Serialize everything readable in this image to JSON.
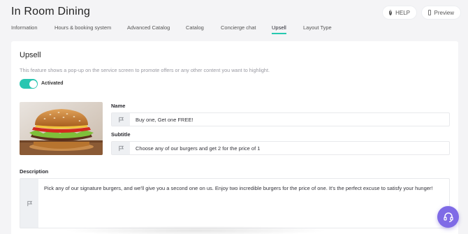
{
  "header": {
    "title": "In Room Dining",
    "help_label": "HELP",
    "preview_label": "Preview"
  },
  "tabs": [
    {
      "label": "Information",
      "active": false
    },
    {
      "label": "Hours & booking system",
      "active": false
    },
    {
      "label": "Advanced Catalog",
      "active": false
    },
    {
      "label": "Catalog",
      "active": false
    },
    {
      "label": "Concierge chat",
      "active": false
    },
    {
      "label": "Upsell",
      "active": true
    },
    {
      "label": "Layout Type",
      "active": false
    }
  ],
  "upsell": {
    "title": "Upsell",
    "description": "This feature shows a pop-up on the service screen to promote offers or any other content you want to highlight.",
    "toggle_label": "Activated",
    "toggle_on": true,
    "name_label": "Name",
    "name_value": "Buy one, Get one FREE!",
    "subtitle_label": "Subtitle",
    "subtitle_value": "Choose any of our burgers and get 2 for the price of 1",
    "description_label": "Description",
    "description_value": "Pick any of our signature burgers, and we'll give you a second one on us. Enjoy two incredible burgers for the price of one. It's the perfect excuse to satisfy your hunger!"
  },
  "colors": {
    "accent": "#29c6b1",
    "fab": "#7f6be6"
  },
  "icons": [
    "question-icon",
    "phone-icon",
    "flag-icon",
    "headset-icon"
  ]
}
